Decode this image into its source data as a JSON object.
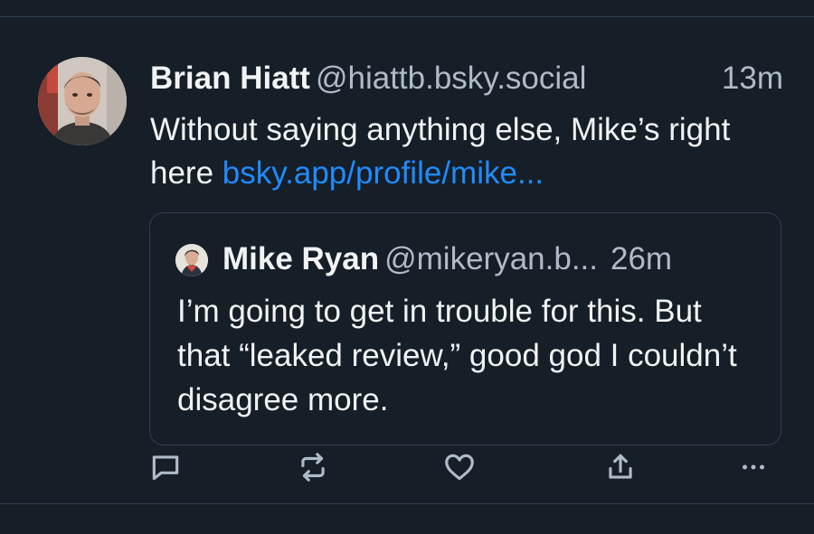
{
  "post": {
    "author_name": "Brian Hiatt",
    "author_handle": "@hiattb.bsky.social",
    "time": "13m",
    "text_before_link": "Without saying anything else, Mike’s right here ",
    "link_text": "bsky.app/profile/mike..."
  },
  "quote": {
    "author_name": "Mike Ryan",
    "author_handle": "@mikeryan.b...",
    "time": "26m",
    "text": "I’m going to get in trouble for this. But that “leaked review,” good god I couldn’t disagree more."
  },
  "actions": {
    "reply_icon": "reply-icon",
    "repost_icon": "repost-icon",
    "like_icon": "heart-icon",
    "share_icon": "share-icon",
    "more_icon": "more-icon"
  },
  "colors": {
    "background": "#161e27",
    "border": "#2e4052",
    "text_primary": "#f1f3f5",
    "text_secondary": "#aebbc9",
    "link": "#208bfe"
  }
}
